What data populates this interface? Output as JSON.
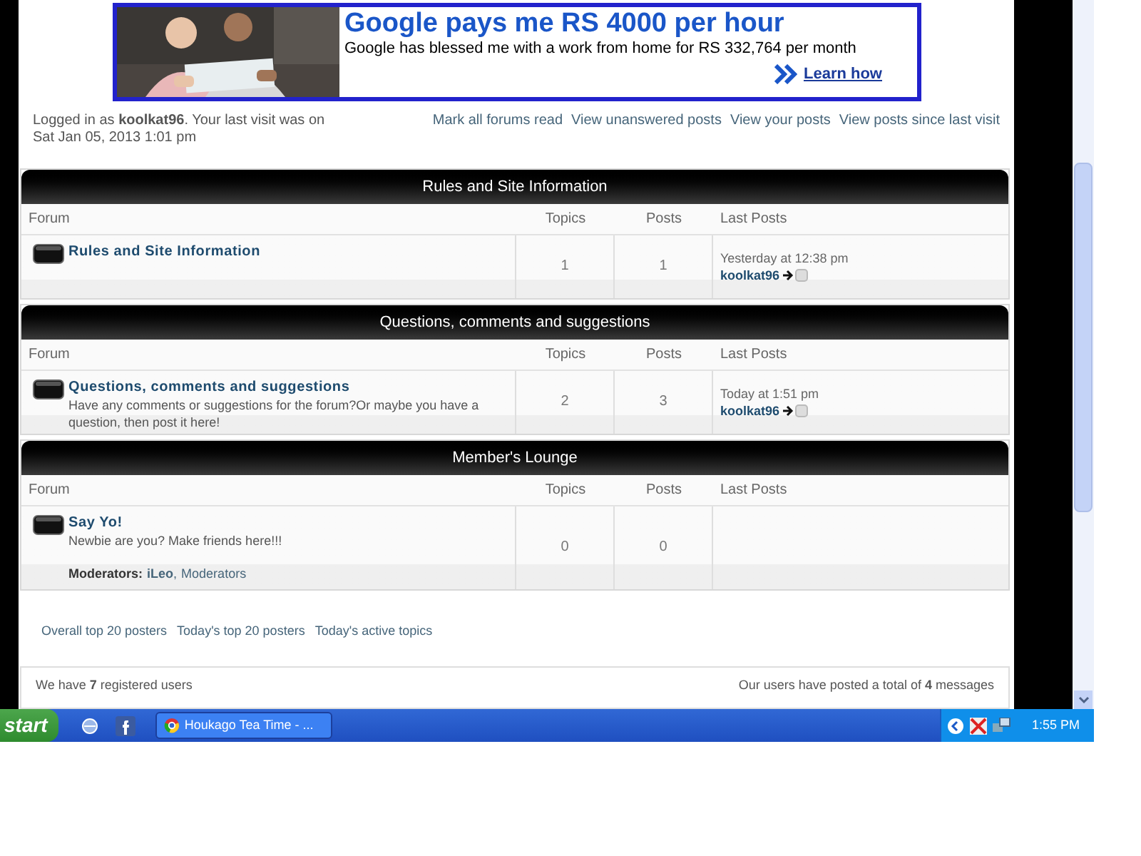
{
  "ad": {
    "headline": "Google pays me RS 4000 per hour",
    "subline": "Google has blessed me with a work from home for RS 332,764 per month",
    "link": "Learn how"
  },
  "welcome": {
    "text": "Logged in as **koolkat96**. Your last visit was on Sat Jan 05, 2013 1:01 pm"
  },
  "top_links": [
    "Mark all forums read",
    "View unanswered posts",
    "View your posts",
    "View posts since last visit"
  ],
  "categories": [
    {
      "title": "Rules and Site Information",
      "columns": [
        "Forum",
        "Topics",
        "Posts",
        "Last Posts"
      ],
      "forums": [
        {
          "name": "Rules and Site Information",
          "topics": "1",
          "posts": "1",
          "last_time": "Yesterday at 12:38 pm",
          "last_user": "koolkat96"
        }
      ]
    },
    {
      "title": "Questions, comments and suggestions",
      "columns": [
        "Forum",
        "Topics",
        "Posts",
        "Last Posts"
      ],
      "forums": [
        {
          "name": "Questions, comments and suggestions",
          "description": "Have any comments or suggestions for the forum?Or maybe you have a question, then post it here!",
          "topics": "2",
          "posts": "3",
          "last_time": "Today at 1:51 pm",
          "last_user": "koolkat96"
        }
      ]
    },
    {
      "title": "Member's Lounge",
      "columns": [
        "Forum",
        "Topics",
        "Posts",
        "Last Posts"
      ],
      "forums": [
        {
          "name": "Say Yo!",
          "description": "Newbie are you? Make friends here!!!",
          "moderators_label": "Moderators:",
          "moderators": [
            "iLeo",
            "Moderators"
          ],
          "moderators_separator": ",",
          "topics": "0",
          "posts": "0"
        }
      ]
    }
  ],
  "bottom_links": [
    "Overall top 20 posters",
    "Today's top 20 posters",
    "Today's active topics"
  ],
  "stats": {
    "left": "We have **7** registered users",
    "right": "Our users have posted a total of **4** messages"
  },
  "taskbar": {
    "start": "start",
    "tasks": [
      {
        "label": "Houkago Tea Time - ...",
        "selected": false
      }
    ],
    "clock": "1:55 PM"
  }
}
